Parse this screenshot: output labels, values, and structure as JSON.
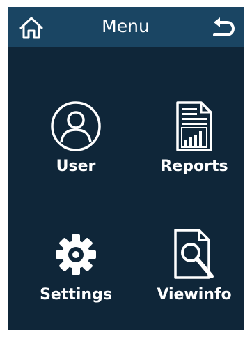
{
  "header": {
    "title": "Menu",
    "home_icon": "home-icon",
    "back_icon": "back-arrow-icon"
  },
  "menu": {
    "items": [
      {
        "label": "User",
        "icon": "user-icon"
      },
      {
        "label": "Reports",
        "icon": "report-chart-icon"
      },
      {
        "label": "Settings",
        "icon": "gear-icon"
      },
      {
        "label": "Viewinfo",
        "icon": "document-search-icon"
      }
    ]
  },
  "colors": {
    "background": "#0f2639",
    "header": "#1a4563",
    "foreground": "#ffffff"
  }
}
